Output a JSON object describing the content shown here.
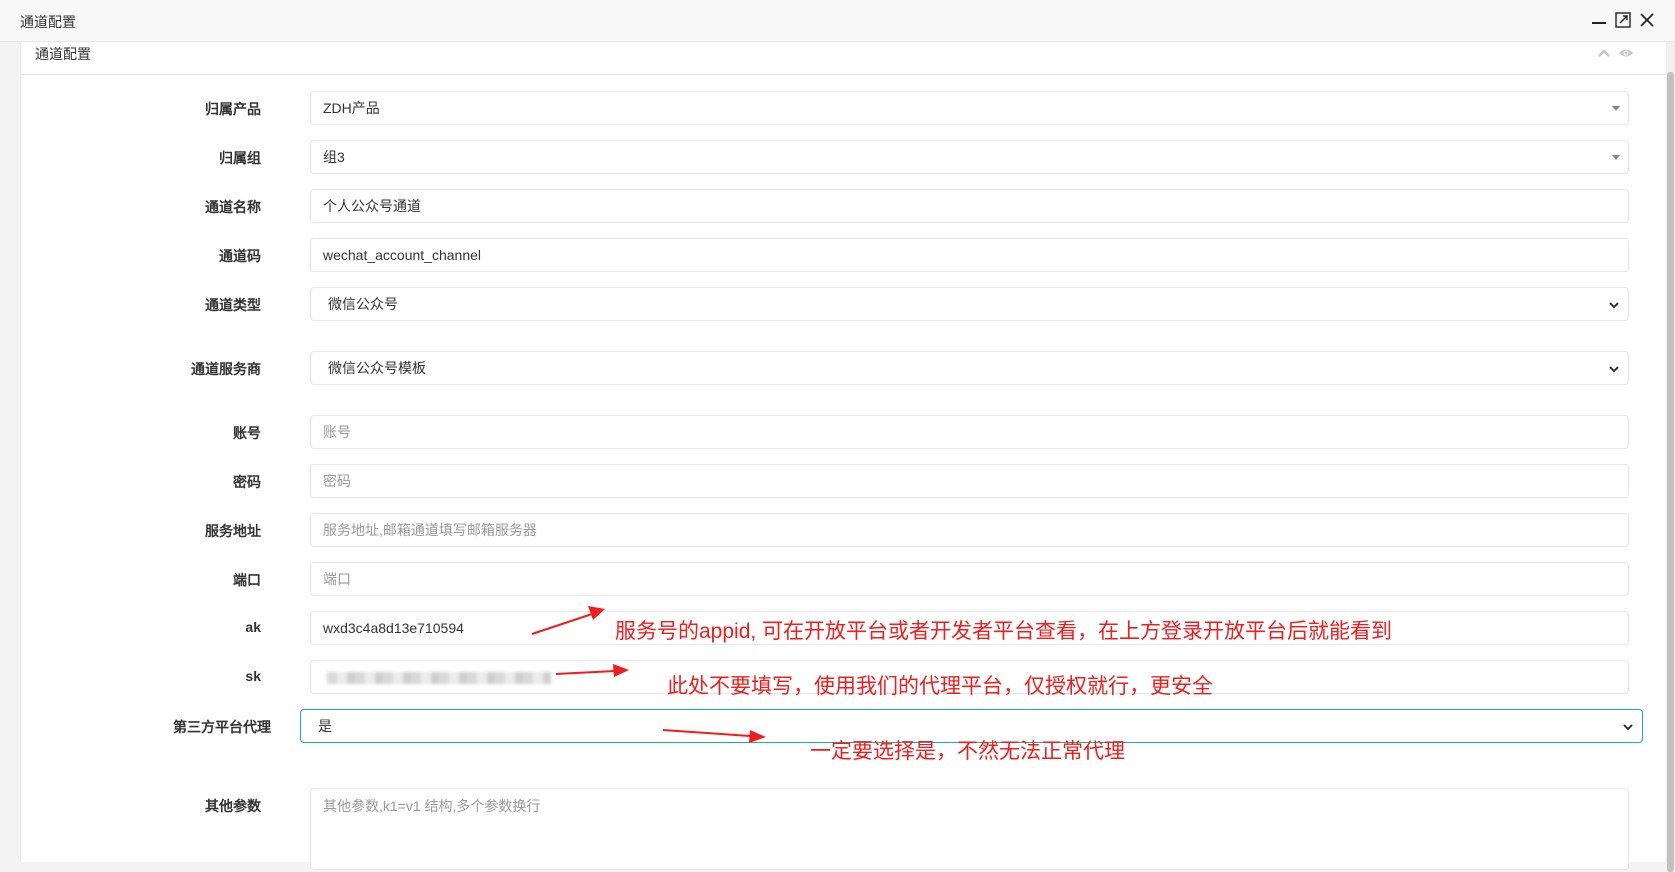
{
  "window": {
    "title": "通道配置"
  },
  "panel": {
    "title": "通道配置"
  },
  "form": {
    "product": {
      "label": "归属产品",
      "value": "ZDH产品"
    },
    "group": {
      "label": "归属组",
      "value": "组3"
    },
    "channel_name": {
      "label": "通道名称",
      "value": "个人公众号通道"
    },
    "channel_code": {
      "label": "通道码",
      "value": "wechat_account_channel"
    },
    "channel_type": {
      "label": "通道类型",
      "value": "微信公众号"
    },
    "provider": {
      "label": "通道服务商",
      "value": "微信公众号模板"
    },
    "account": {
      "label": "账号",
      "placeholder": "账号"
    },
    "password": {
      "label": "密码",
      "placeholder": "密码"
    },
    "server": {
      "label": "服务地址",
      "placeholder": "服务地址,邮箱通道填写邮箱服务器"
    },
    "port": {
      "label": "端口",
      "placeholder": "端口"
    },
    "ak": {
      "label": "ak",
      "value": "wxd3c4a8d13e710594"
    },
    "sk": {
      "label": "sk",
      "value": ""
    },
    "proxy": {
      "label": "第三方平台代理",
      "value": "是"
    },
    "other": {
      "label": "其他参数",
      "placeholder": "其他参数,k1=v1 结构,多个参数换行"
    }
  },
  "annotations": {
    "ak_note": "服务号的appid, 可在开放平台或者开发者平台查看，在上方登录开放平台后就能看到",
    "sk_note": "此处不要填写，使用我们的代理平台，仅授权就行，更安全",
    "proxy_note": "一定要选择是，不然无法正常代理",
    "color": "#f11d1d"
  },
  "colors": {
    "focus_border": "#1ab394"
  }
}
